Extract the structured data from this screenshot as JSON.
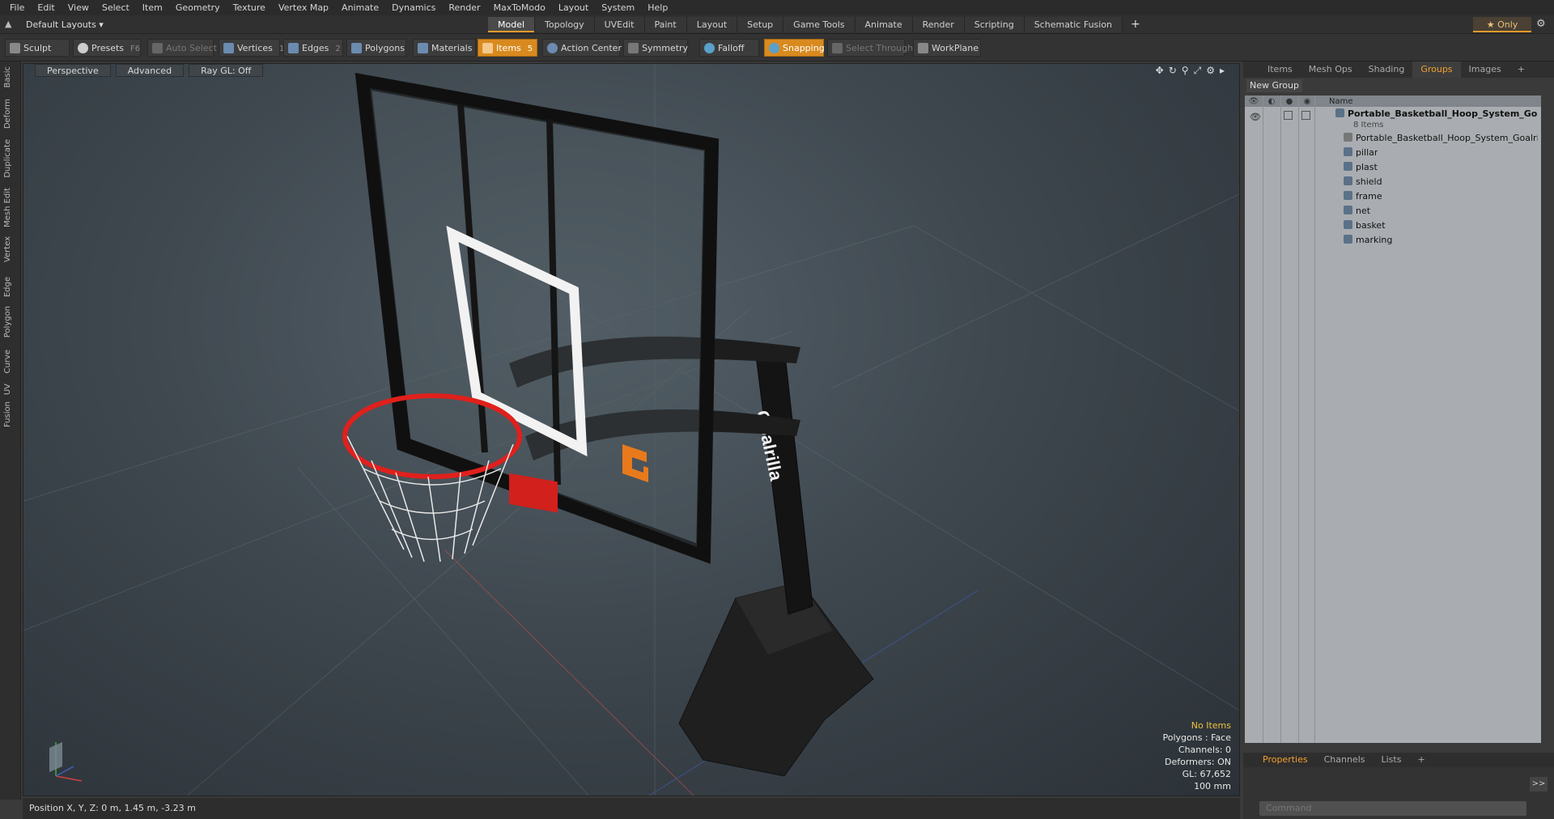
{
  "menu": [
    "File",
    "Edit",
    "View",
    "Select",
    "Item",
    "Geometry",
    "Texture",
    "Vertex Map",
    "Animate",
    "Dynamics",
    "Render",
    "MaxToModo",
    "Layout",
    "System",
    "Help"
  ],
  "layout_dropdown": "Default Layouts ▾",
  "layout_tabs": [
    "Model",
    "Topology",
    "UVEdit",
    "Paint",
    "Layout",
    "Setup",
    "Game Tools",
    "Animate",
    "Render",
    "Scripting",
    "Schematic Fusion"
  ],
  "active_tab": "Model",
  "only_label": "★ Only",
  "toolbar": {
    "sculpt": "Sculpt",
    "presets": "Presets",
    "presets_key": "F6",
    "auto_select": "Auto Select",
    "vertices": "Vertices",
    "vertices_key": "1",
    "edges": "Edges",
    "edges_key": "2",
    "polygons": "Polygons",
    "materials": "Materials",
    "items": "Items",
    "items_key": "5",
    "action_center": "Action Center",
    "symmetry": "Symmetry",
    "falloff": "Falloff",
    "snapping": "Snapping",
    "select_through": "Select Through",
    "workplane": "WorkPlane"
  },
  "left_tabs": [
    "Basic",
    "Deform",
    "Duplicate",
    "Mesh Edit",
    "Vertex",
    "Edge",
    "Polygon",
    "Curve",
    "UV",
    "Fusion"
  ],
  "viewport": {
    "view": "Perspective",
    "shading": "Advanced",
    "raygl": "Ray GL: Off",
    "backboard_brand": "Goalrilla",
    "stats": {
      "no_items": "No Items",
      "polygons": "Polygons : Face",
      "channels": "Channels: 0",
      "deformers": "Deformers: ON",
      "gl": "GL: 67,652",
      "scale": "100 mm"
    }
  },
  "status": "Position X, Y, Z:  0 m, 1.45 m, -3.23 m",
  "right_panel": {
    "tabs": [
      "Items",
      "Mesh Ops",
      "Shading",
      "Groups",
      "Images"
    ],
    "active_tab": "Groups",
    "new_group": "New Group",
    "col_name": "Name",
    "root": {
      "name": "Portable_Basketball_Hoop_System_Go...",
      "count": "8 Items"
    },
    "children": [
      "Portable_Basketball_Hoop_System_Goalrilla",
      "pillar",
      "plast",
      "shield",
      "frame",
      "net",
      "basket",
      "marking"
    ],
    "bottom_tabs": [
      "Properties",
      "Channels",
      "Lists"
    ],
    "bottom_active": "Properties",
    "command_placeholder": "Command",
    "expand": ">>"
  }
}
